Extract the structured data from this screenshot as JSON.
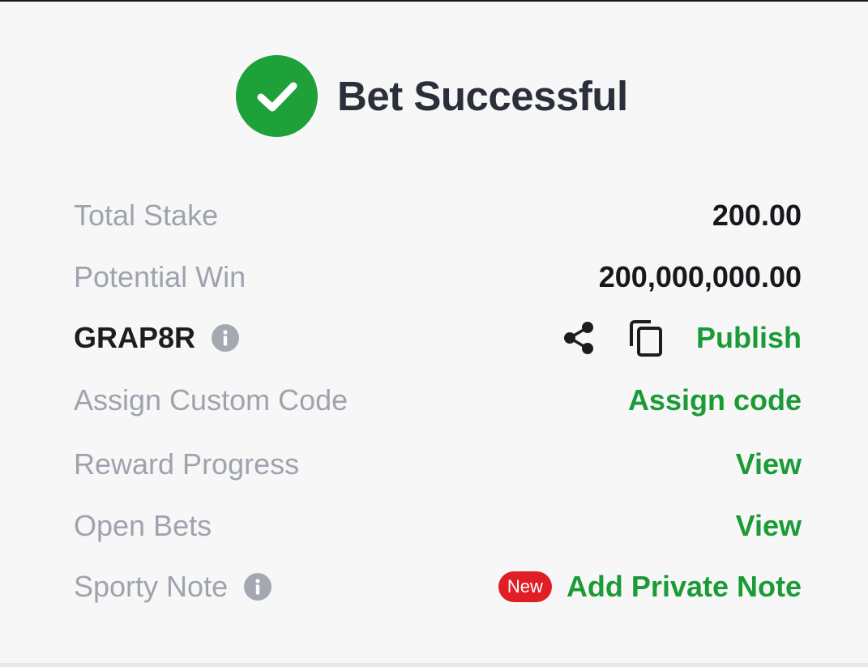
{
  "header": {
    "title": "Bet Successful",
    "check_color": "#1fa13a"
  },
  "rows": {
    "total_stake": {
      "label": "Total Stake",
      "value": "200.00"
    },
    "potential_win": {
      "label": "Potential Win",
      "value": "200,000,000.00"
    },
    "booking_code": {
      "code": "GRAP8R",
      "publish_label": "Publish"
    },
    "custom_code": {
      "label": "Assign Custom Code",
      "action": "Assign code"
    },
    "reward_progress": {
      "label": "Reward Progress",
      "action": "View"
    },
    "open_bets": {
      "label": "Open Bets",
      "action": "View"
    },
    "sporty_note": {
      "label": "Sporty Note",
      "badge": "New",
      "action": "Add Private Note"
    }
  },
  "colors": {
    "accent_green": "#1a9b35",
    "badge_red": "#e11d26",
    "muted_label": "#9ea3ad"
  }
}
